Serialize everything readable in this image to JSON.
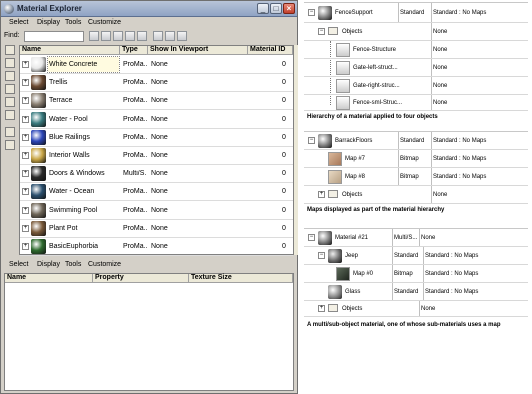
{
  "window": {
    "title": "Material Explorer",
    "btn_min": "_",
    "btn_max": "□",
    "btn_close": "×"
  },
  "menu_top": [
    "Select",
    "Display",
    "Tools",
    "Customize"
  ],
  "menu_bottom": [
    "Select",
    "Display",
    "Tools",
    "Customize"
  ],
  "find": {
    "label": "Find:",
    "value": ""
  },
  "toolbar_icons": [
    "select-all-icon",
    "select-none-icon",
    "select-invert-icon",
    "sync-icon",
    "display-icon",
    "lock-icon",
    "filter-icon",
    "options-icon"
  ],
  "grid": {
    "columns": [
      "Name",
      "Type",
      "Show In Viewport",
      "Material ID"
    ],
    "rows": [
      {
        "name": "White Concrete",
        "type": "ProMa...",
        "viewport": "None",
        "id": "0",
        "color": "#e8e8e8"
      },
      {
        "name": "Trellis",
        "type": "ProMa...",
        "viewport": "None",
        "id": "0",
        "color": "#6b4a33"
      },
      {
        "name": "Terrace",
        "type": "ProMa...",
        "viewport": "None",
        "id": "0",
        "color": "#8a7f72"
      },
      {
        "name": "Water - Pool",
        "type": "ProMa...",
        "viewport": "None",
        "id": "0",
        "color": "#3a7c80"
      },
      {
        "name": "Blue Railings",
        "type": "ProMa...",
        "viewport": "None",
        "id": "0",
        "color": "#2b45b8"
      },
      {
        "name": "Interior Walls",
        "type": "ProMa...",
        "viewport": "None",
        "id": "0",
        "color": "#c9a646"
      },
      {
        "name": "Doors & Windows",
        "type": "Multi/S...",
        "viewport": "None",
        "id": "0",
        "color": "#2a2a2a"
      },
      {
        "name": "Water - Ocean",
        "type": "ProMa...",
        "viewport": "None",
        "id": "0",
        "color": "#2a4f6e"
      },
      {
        "name": "Swimming Pool",
        "type": "ProMa...",
        "viewport": "None",
        "id": "0",
        "color": "#6f6658"
      },
      {
        "name": "Plant Pot",
        "type": "ProMa...",
        "viewport": "None",
        "id": "0",
        "color": "#7a5a3a"
      },
      {
        "name": "BasicEuphorbia",
        "type": "ProMa...",
        "viewport": "None",
        "id": "0",
        "color": "#2e6b2e"
      }
    ]
  },
  "lower_panel": {
    "columns": [
      "Name",
      "Property",
      "Texture Size"
    ]
  },
  "example1": {
    "caption": "Hierarchy of a material applied to four objects",
    "root": {
      "name": "FenceSupport",
      "type": "Standard",
      "detail": "Standard : No Maps"
    },
    "objects_label": "Objects",
    "objects_value": "None",
    "children": [
      {
        "name": "Fence-Structure",
        "value": "None"
      },
      {
        "name": "Gate-left-struct...",
        "value": "None"
      },
      {
        "name": "Gate-right-struc...",
        "value": "None"
      },
      {
        "name": "Fence-sml-Struc...",
        "value": "None"
      }
    ]
  },
  "example2": {
    "caption": "Maps displayed as part of the material hierarchy",
    "root": {
      "name": "BarrackFloors",
      "type": "Standard",
      "detail": "Standard : No Maps"
    },
    "maps": [
      {
        "name": "Map #7",
        "type": "Bitmap",
        "detail": "Standard : No Maps"
      },
      {
        "name": "Map #8",
        "type": "Bitmap",
        "detail": "Standard : No Maps"
      }
    ],
    "objects_label": "Objects",
    "objects_value": "None"
  },
  "example3": {
    "caption": "A multi/sub-object material, one of whose sub-materials uses a map",
    "root": {
      "name": "Material #21",
      "type": "Multi/S...",
      "detail": "None"
    },
    "subs": [
      {
        "name": "Jeep",
        "type": "Standard",
        "detail": "Standard : No Maps"
      },
      {
        "name": "Map #0",
        "type": "Bitmap",
        "detail": "Standard : No Maps"
      },
      {
        "name": "Glass",
        "type": "Standard",
        "detail": "Standard : No Maps"
      }
    ],
    "objects_label": "Objects",
    "objects_value": "None"
  },
  "colors": {
    "title_gradient_top": "#b8c4d8",
    "window_bg": "#d4d0c8",
    "selection_bg": "#fffbe0"
  }
}
